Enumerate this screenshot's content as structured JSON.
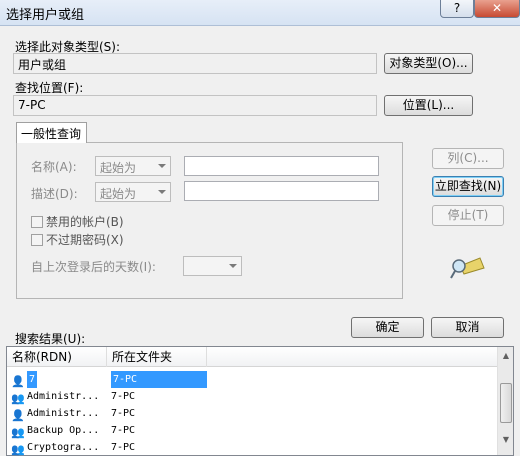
{
  "window": {
    "title": "选择用户或组",
    "help_glyph": "?",
    "close_glyph": "✕"
  },
  "object_type": {
    "label": "选择此对象类型(S):",
    "value": "用户或组",
    "button": "对象类型(O)..."
  },
  "location": {
    "label": "查找位置(F):",
    "value": "7-PC",
    "button": "位置(L)..."
  },
  "query": {
    "tab_label": "一般性查询",
    "name_label": "名称(A):",
    "name_mode": "起始为",
    "desc_label": "描述(D):",
    "desc_mode": "起始为",
    "disabled_accounts": "禁用的帐户(B)",
    "non_expiring": "不过期密码(X)",
    "days_since_login": "自上次登录后的天数(I):"
  },
  "side_buttons": {
    "columns": "列(C)...",
    "find_now": "立即查找(N)",
    "stop": "停止(T)"
  },
  "search_results": {
    "label": "搜索结果(U):"
  },
  "action_buttons": {
    "ok": "确定",
    "cancel": "取消"
  },
  "results": {
    "columns": [
      "名称(RDN)",
      "所在文件夹"
    ],
    "rows": [
      {
        "name": "7",
        "folder": "7-PC",
        "icon": "user-icon",
        "selected": true
      },
      {
        "name": "Administr...",
        "folder": "7-PC",
        "icon": "group-icon"
      },
      {
        "name": "Administr...",
        "folder": "7-PC",
        "icon": "user-icon"
      },
      {
        "name": "Backup Op...",
        "folder": "7-PC",
        "icon": "group-icon"
      },
      {
        "name": "Cryptogra...",
        "folder": "7-PC",
        "icon": "group-icon"
      }
    ]
  },
  "colors": {
    "selection": "#3399ff",
    "accent": "#3c7fb1"
  }
}
